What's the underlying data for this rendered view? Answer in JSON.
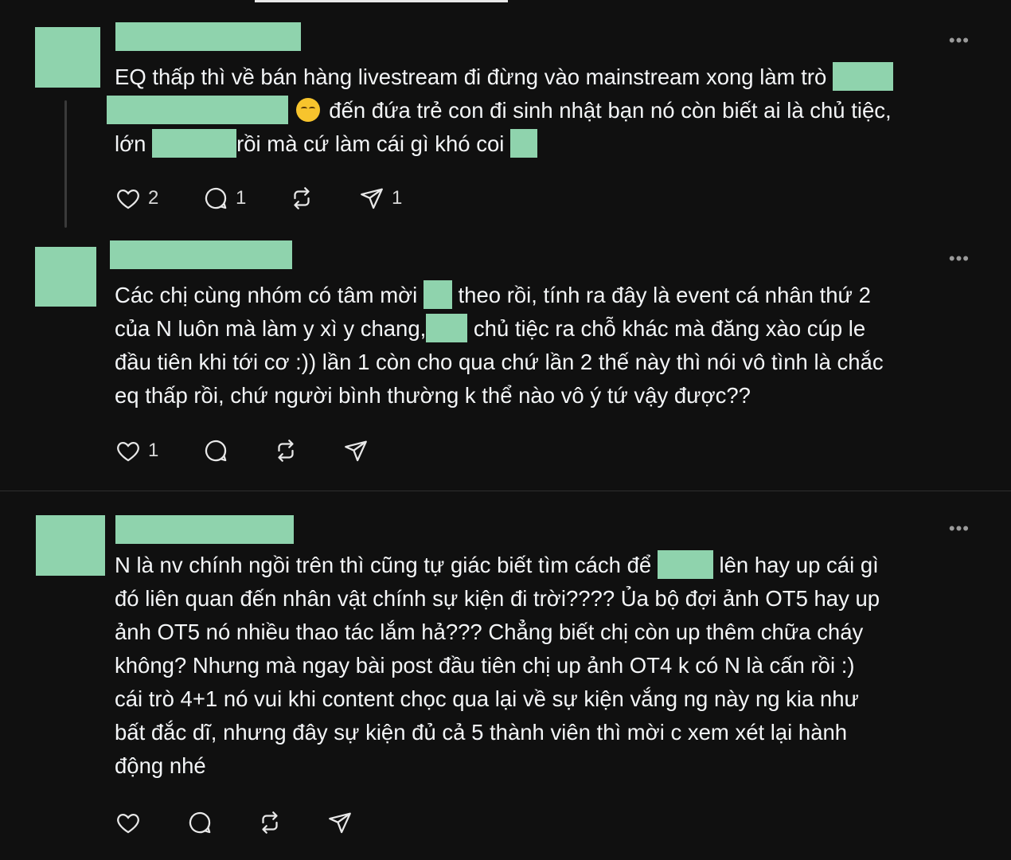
{
  "posts": [
    {
      "more_label": "•••",
      "text_lines": [
        [
          "EQ thấp thì về bán hàng livestream đi đừng vào mainstream xong làm trò ",
          ""
        ],
        [
          "",
          " đến đứa trẻ con đi sinh nhật bạn nó còn biết ai là chủ tiệc,"
        ],
        [
          "lớn ",
          "rồi mà cứ làm cái gì khó coi ",
          ""
        ]
      ],
      "emoji": "tired-face-emoji",
      "likes": "2",
      "replies": "1",
      "reposts": "",
      "shares": "1"
    },
    {
      "more_label": "•••",
      "text_lines": [
        "Các chị cùng nhóm có tâm mời ",
        " theo rồi, tính ra đây là event cá nhân thứ 2",
        "của N luôn mà làm y xì y chang,",
        " chủ tiệc ra chỗ khác mà đăng xào cúp le",
        "đầu tiên khi tới cơ :)) lần 1 còn cho qua chứ lần 2 thế này thì nói vô tình là chắc",
        "eq thấp rồi, chứ người bình thường k thể nào vô ý tứ vậy được??"
      ],
      "likes": "1",
      "replies": "",
      "reposts": "",
      "shares": ""
    },
    {
      "more_label": "•••",
      "text_lines": [
        "N là nv chính ngồi trên thì cũng tự giác biết tìm cách để ",
        " lên hay up cái gì",
        "đó liên quan đến nhân vật chính sự kiện đi trời???? Ủa bộ đợi ảnh OT5 hay up",
        "ảnh OT5 nó nhiều thao tác lắm hả??? Chẳng biết chị còn up thêm chữa cháy",
        "không? Nhưng mà ngay bài post đầu tiên chị up ảnh OT4 k có N là cấn rồi :)",
        "cái trò 4+1 nó vui khi content chọc qua lại về sự kiện vắng ng này ng kia như",
        "bất đắc dĩ, nhưng đây sự kiện đủ cả 5 thành viên thì mời c xem xét lại hành",
        "động nhé"
      ],
      "likes": "",
      "replies": "",
      "reposts": "",
      "shares": ""
    }
  ],
  "icons": {
    "like": "heart-icon",
    "reply": "comment-icon",
    "repost": "repost-icon",
    "share": "send-icon",
    "more": "more-icon"
  },
  "colors": {
    "background": "#101010",
    "text": "#f3f5f7",
    "redaction": "#8fd3ad",
    "divider": "#2f2f2f"
  }
}
